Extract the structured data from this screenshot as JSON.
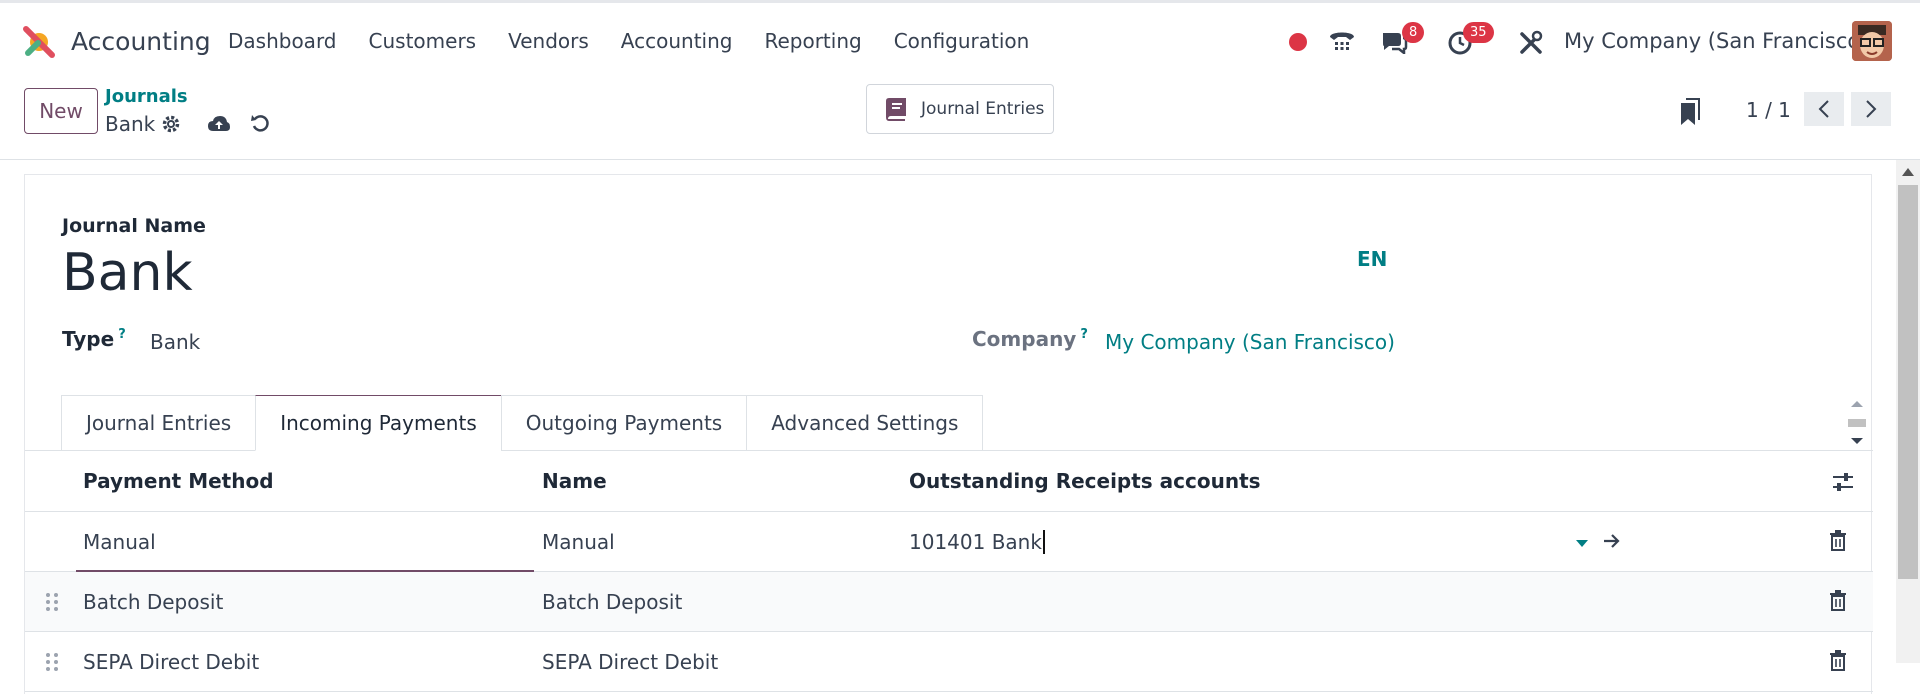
{
  "navbar": {
    "app_name": "Accounting",
    "menu": [
      "Dashboard",
      "Customers",
      "Vendors",
      "Accounting",
      "Reporting",
      "Configuration"
    ],
    "messages_count": "8",
    "activities_count": "35",
    "company": "My Company (San Francisco)"
  },
  "control": {
    "new_label": "New",
    "breadcrumb_parent": "Journals",
    "breadcrumb_current": "Bank",
    "smart_button": "Journal Entries",
    "pager": "1 / 1"
  },
  "form": {
    "journal_name_label": "Journal Name",
    "journal_name": "Bank",
    "lang": "EN",
    "type_label": "Type",
    "type_help": "?",
    "type_value": "Bank",
    "company_label": "Company",
    "company_help": "?",
    "company_value": "My Company (San Francisco)"
  },
  "tabs": [
    {
      "label": "Journal Entries",
      "active": false
    },
    {
      "label": "Incoming Payments",
      "active": true
    },
    {
      "label": "Outgoing Payments",
      "active": false
    },
    {
      "label": "Advanced Settings",
      "active": false
    }
  ],
  "table": {
    "headers": [
      "Payment Method",
      "Name",
      "Outstanding Receipts accounts"
    ],
    "rows": [
      {
        "method": "Manual",
        "name": "Manual",
        "account": "101401 Bank"
      },
      {
        "method": "Batch Deposit",
        "name": "Batch Deposit",
        "account": ""
      },
      {
        "method": "SEPA Direct Debit",
        "name": "SEPA Direct Debit",
        "account": ""
      }
    ]
  },
  "colors": {
    "brand": "#714b67",
    "teal": "#017e84",
    "danger": "#dc3545"
  }
}
